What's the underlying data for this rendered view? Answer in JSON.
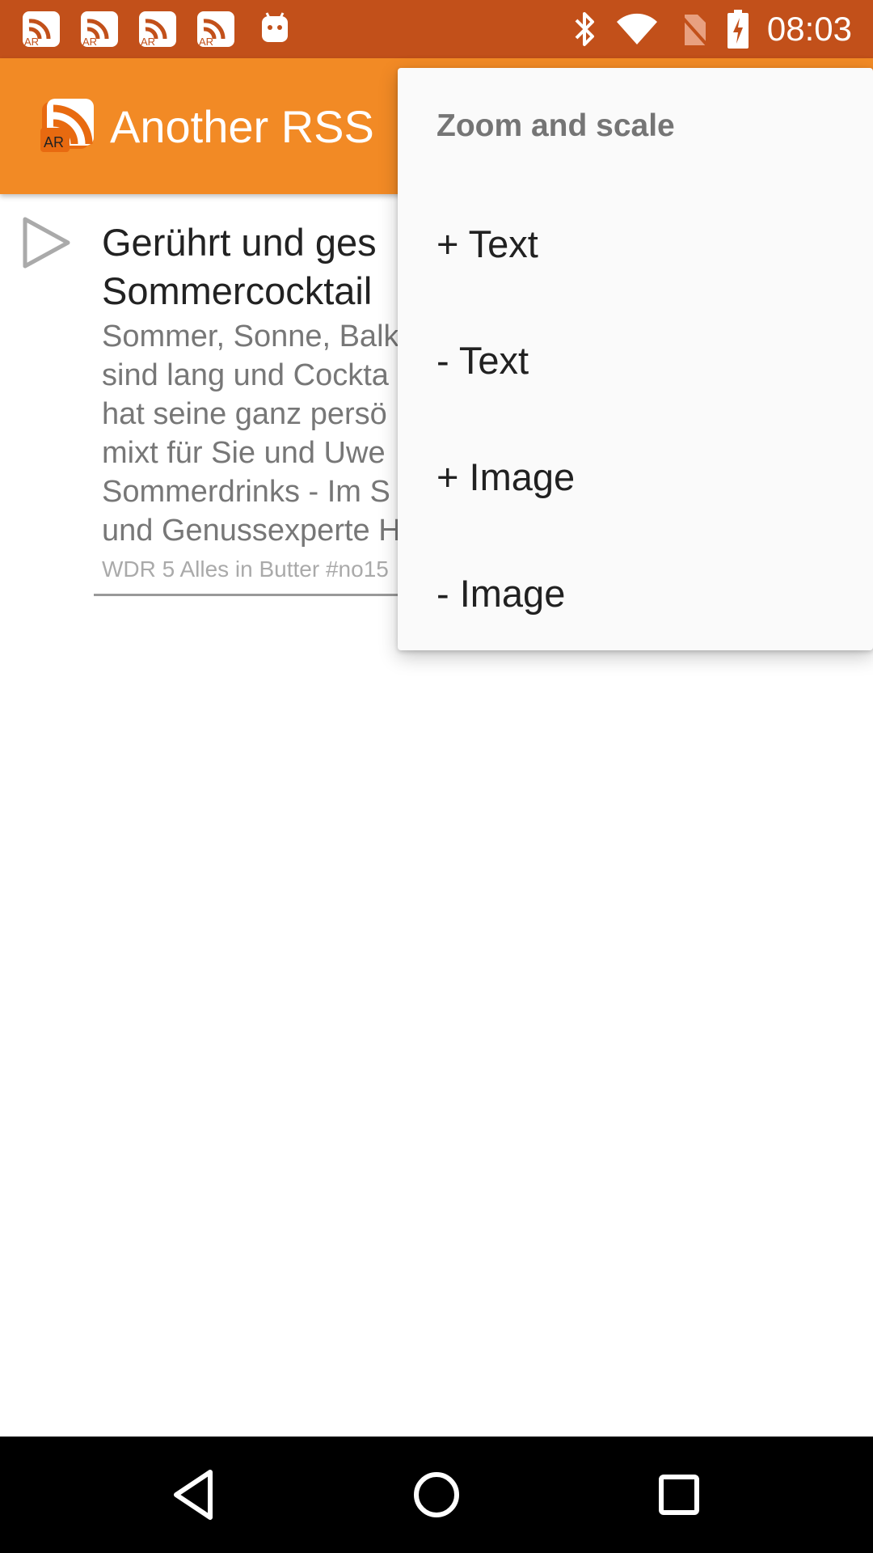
{
  "status_bar": {
    "time": "08:03",
    "notification_icons": [
      "another-rss-icon",
      "another-rss-icon",
      "another-rss-icon",
      "another-rss-icon",
      "android-icon"
    ],
    "notification_badge_text": "AR",
    "system_icons": [
      "bluetooth-icon",
      "wifi-icon",
      "no-sim-icon",
      "battery-charging-icon"
    ]
  },
  "app_bar": {
    "title": "Another RSS",
    "logo_text": "AR",
    "color": "#f28a25"
  },
  "article": {
    "title": "Gerührt und ges\nSommercocktail",
    "summary": "Sommer, Sonne, Balk\nsind lang und Cockta\nhat seine ganz persö\nmixt für Sie und Uwe\nSommerdrinks - Im S\nund Genussexperte H",
    "source": "WDR 5 Alles in Butter #no15"
  },
  "menu": {
    "header": "Zoom and scale",
    "items": [
      {
        "label": "+ Text"
      },
      {
        "label": "- Text"
      },
      {
        "label": "+ Image"
      },
      {
        "label": "- Image"
      }
    ]
  },
  "nav_bar": {
    "buttons": [
      "back-icon",
      "home-icon",
      "recents-icon"
    ]
  },
  "colors": {
    "status_bar": "#c2501a",
    "accent": "#f28a25",
    "menu_background": "#fafafa"
  }
}
